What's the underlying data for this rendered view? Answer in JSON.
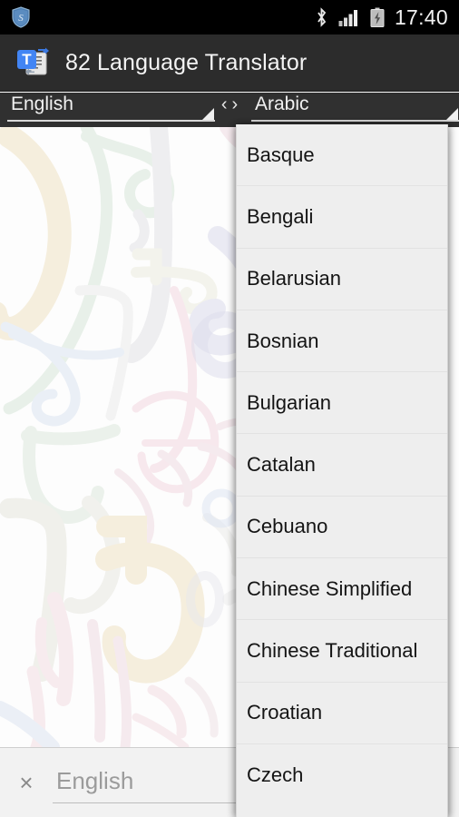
{
  "status_bar": {
    "left_icons": [
      {
        "name": "security-shield-icon",
        "glyph": "shield"
      }
    ],
    "right_icons": [
      {
        "name": "bluetooth-icon",
        "glyph": "bluetooth"
      },
      {
        "name": "signal-bars-icon",
        "glyph": "signal"
      },
      {
        "name": "battery-charging-icon",
        "glyph": "battery-charging"
      }
    ],
    "clock": "17:40",
    "background_color": "#000000",
    "text_color": "#f2f2f2"
  },
  "action_bar": {
    "app_icon_name": "app-icon-translator",
    "title": "82 Language Translator",
    "background_color": "#2c2c2c"
  },
  "language_selector": {
    "source": {
      "label": "English",
      "icon": "dropdown-caret-icon"
    },
    "swap": {
      "name": "swap-languages-button",
      "left_chevron": "‹",
      "right_chevron": "›"
    },
    "target": {
      "label": "Arabic",
      "icon": "dropdown-caret-icon"
    },
    "background_color": "#303030"
  },
  "dropdown": {
    "name": "target-language-dropdown",
    "open": true,
    "background_color": "#eeeeee",
    "items": [
      "Basque",
      "Bengali",
      "Belarusian",
      "Bosnian",
      "Bulgarian",
      "Catalan",
      "Cebuano",
      "Chinese Simplified",
      "Chinese Traditional",
      "Croatian",
      "Czech"
    ]
  },
  "input_bar": {
    "clear_label": "×",
    "placeholder": "English",
    "value": "",
    "background_color": "#f2f2f2"
  },
  "wallpaper": {
    "description": "pastel calligraphic letters on white",
    "base_color": "#fdfdfd",
    "accent_colors": [
      "#f2e6cf",
      "#dfe9e0",
      "#e6e9f2",
      "#f5dde4",
      "#e9e9ec"
    ]
  }
}
